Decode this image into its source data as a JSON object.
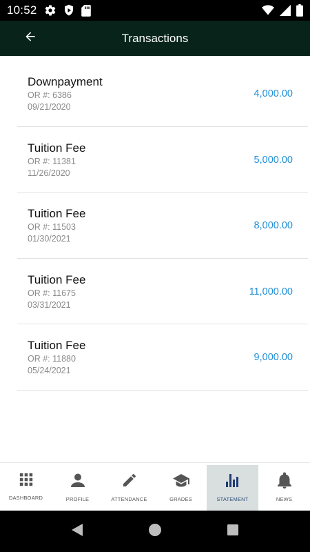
{
  "status_bar": {
    "time": "10:52",
    "left_icons": [
      "gear-icon",
      "shield-play-icon",
      "sd-card-icon"
    ],
    "right_icons": [
      "wifi-icon",
      "signal-icon",
      "battery-icon"
    ]
  },
  "app_bar": {
    "title": "Transactions",
    "back_icon": "arrow-left-icon"
  },
  "transactions": [
    {
      "title": "Downpayment",
      "or_number": "OR #: 6386",
      "date": "09/21/2020",
      "amount": "4,000.00"
    },
    {
      "title": "Tuition Fee",
      "or_number": "OR #: 11381",
      "date": "11/26/2020",
      "amount": "5,000.00"
    },
    {
      "title": "Tuition Fee",
      "or_number": "OR #: 11503",
      "date": "01/30/2021",
      "amount": "8,000.00"
    },
    {
      "title": "Tuition Fee",
      "or_number": "OR #: 11675",
      "date": "03/31/2021",
      "amount": "11,000.00"
    },
    {
      "title": "Tuition Fee",
      "or_number": "OR #: 11880",
      "date": "05/24/2021",
      "amount": "9,000.00"
    }
  ],
  "bottom_nav": {
    "items": [
      {
        "label": "DASHBOARD",
        "icon": "grid-icon"
      },
      {
        "label": "PROFILE",
        "icon": "person-icon"
      },
      {
        "label": "ATTENDANCE",
        "icon": "pencil-icon"
      },
      {
        "label": "GRADES",
        "icon": "graduation-cap-icon"
      },
      {
        "label": "STATEMENT",
        "icon": "bar-chart-icon",
        "active": true
      },
      {
        "label": "NEWS",
        "icon": "bell-icon"
      }
    ]
  },
  "system_nav": {
    "buttons": [
      "back-triangle-icon",
      "home-circle-icon",
      "recents-square-icon"
    ]
  },
  "colors": {
    "app_bar": "#07231a",
    "amount": "#1e8fd8",
    "active_tab_bg": "#d9dfdf",
    "active_icon": "#1f3a73"
  }
}
